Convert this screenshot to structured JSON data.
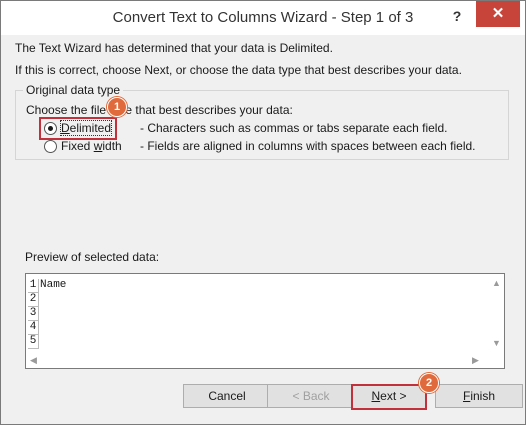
{
  "window": {
    "title": "Convert Text to Columns Wizard - Step 1 of 3",
    "help_label": "?",
    "close_label": "✕"
  },
  "intro": {
    "line1": "The Text Wizard has determined that your data is Delimited.",
    "line2": "If this is correct, choose Next, or choose the data type that best describes your data."
  },
  "original_data_type": {
    "legend": "Original data type",
    "prompt": "Choose the file type that best describes your data:",
    "options": [
      {
        "label_u": "D",
        "label_rest": "elimited",
        "description": "- Characters such as commas or tabs separate each field.",
        "selected": true
      },
      {
        "label_pre": "Fixed ",
        "label_u": "w",
        "label_rest": "idth",
        "description": "- Fields are aligned in columns with spaces between each field.",
        "selected": false
      }
    ]
  },
  "preview": {
    "label": "Preview of selected data:",
    "rows": [
      {
        "num": "1",
        "text": "Name"
      },
      {
        "num": "2",
        "text": ""
      },
      {
        "num": "3",
        "text": ""
      },
      {
        "num": "4",
        "text": ""
      },
      {
        "num": "5",
        "text": ""
      }
    ]
  },
  "buttons": {
    "cancel": "Cancel",
    "back": "< Back",
    "next_u": "N",
    "next_rest": "ext >",
    "finish_u": "F",
    "finish_rest": "inish"
  },
  "annotations": {
    "badge1": "1",
    "badge2": "2",
    "color": "#e06a3c"
  }
}
